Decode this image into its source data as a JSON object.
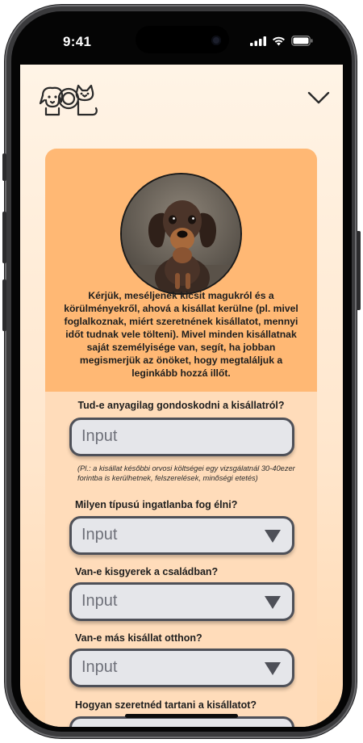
{
  "status_bar": {
    "time": "9:41"
  },
  "header": {
    "logo_icon": "cat-dog-logo-icon",
    "menu_icon": "chevron-down-icon"
  },
  "intro": {
    "photo": "dachshund-puppy-photo",
    "text": "Kérjük, meséljenek kicsit magukról és a körülményekről, ahová a kisállat kerülne (pl. mivel foglalkoznak, miért szeretnének kisállatot, mennyi időt tudnak vele tölteni). Mivel minden kisállatnak saját személyisége van, segít, ha jobban megismerjük az önöket, hogy megtaláljuk a leginkább hozzá illőt."
  },
  "form": {
    "q1": {
      "label": "Tud-e anyagilag gondoskodni a kisállatról?",
      "placeholder": "Input",
      "note": "(Pl.: a kisállat későbbi orvosi költségei egy vizsgálatnál 30-40ezer forintba is kerülhetnek, felszerelések, minőségi etetés)"
    },
    "q2": {
      "label": "Milyen típusú ingatlanba fog élni?",
      "placeholder": "Input"
    },
    "q3": {
      "label": "Van-e kisgyerek a családban?",
      "placeholder": "Input"
    },
    "q4": {
      "label": "Van-e más kisállat otthon?",
      "placeholder": "Input"
    },
    "q5": {
      "label": "Hogyan szeretnéd tartani a kisállatot?"
    }
  },
  "colors": {
    "accent": "#ffb874",
    "background": "#fff4e6",
    "field": "#e5e6ea",
    "field_border": "#4e5058"
  }
}
